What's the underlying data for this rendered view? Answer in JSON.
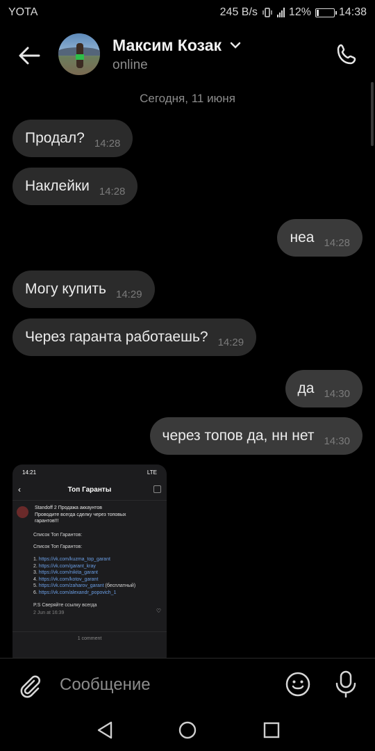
{
  "status_bar": {
    "carrier": "YOTA",
    "net_speed": "245 B/s",
    "battery": "12%",
    "battery_level": 0.12,
    "time": "14:38"
  },
  "header": {
    "contact_name": "Максим Козак",
    "presence": "online"
  },
  "chat": {
    "date_separator": "Сегодня, 11 июня",
    "messages": [
      {
        "dir": "in",
        "text": "Продал?",
        "time": "14:28"
      },
      {
        "dir": "in",
        "text": "Наклейки",
        "time": "14:28"
      },
      {
        "dir": "out",
        "text": "неа",
        "time": "14:28"
      },
      {
        "dir": "in",
        "text": "Могу купить",
        "time": "14:29"
      },
      {
        "dir": "in",
        "text": "Через гаранта работаешь?",
        "time": "14:29"
      },
      {
        "dir": "out",
        "text": "да",
        "time": "14:30"
      },
      {
        "dir": "out",
        "text": "через топов да, нн нет",
        "time": "14:30"
      }
    ],
    "attachment": {
      "phone_time": "14:21",
      "phone_net": "LTE",
      "title": "Топ Гаранты",
      "post_author": "Standoff 2 Продажа аккаунтов",
      "post_line1": "Проводите всегда сделку через топовых",
      "post_line2": "гарантов!!!",
      "list_heading1": "Список Топ Гарантов:",
      "list_heading2": "Список Топ Гарантов:",
      "links": [
        {
          "n": "1.",
          "url": "https://vk.com/kuzma_top_garant",
          "note": ""
        },
        {
          "n": "2.",
          "url": "https://vk.com/garant_kray",
          "note": ""
        },
        {
          "n": "3.",
          "url": "https://vk.com/nikita_garant",
          "note": ""
        },
        {
          "n": "4.",
          "url": "https://vk.com/kotov_garant",
          "note": ""
        },
        {
          "n": "5.",
          "url": "https://vk.com/zaharov_garant",
          "note": "(бесплатный)"
        },
        {
          "n": "6.",
          "url": "https://vk.com/alexandr_popovich_1",
          "note": ""
        }
      ],
      "ps": "P.S Сверяйте ссылку всегда",
      "post_date": "2 Jun at 16:39",
      "comments": "1 comment"
    }
  },
  "composer": {
    "placeholder": "Сообщение"
  },
  "icons": {
    "back": "arrow-left-icon",
    "call": "phone-icon",
    "attach": "paperclip-icon",
    "emoji": "smiley-icon",
    "mic": "microphone-icon"
  }
}
